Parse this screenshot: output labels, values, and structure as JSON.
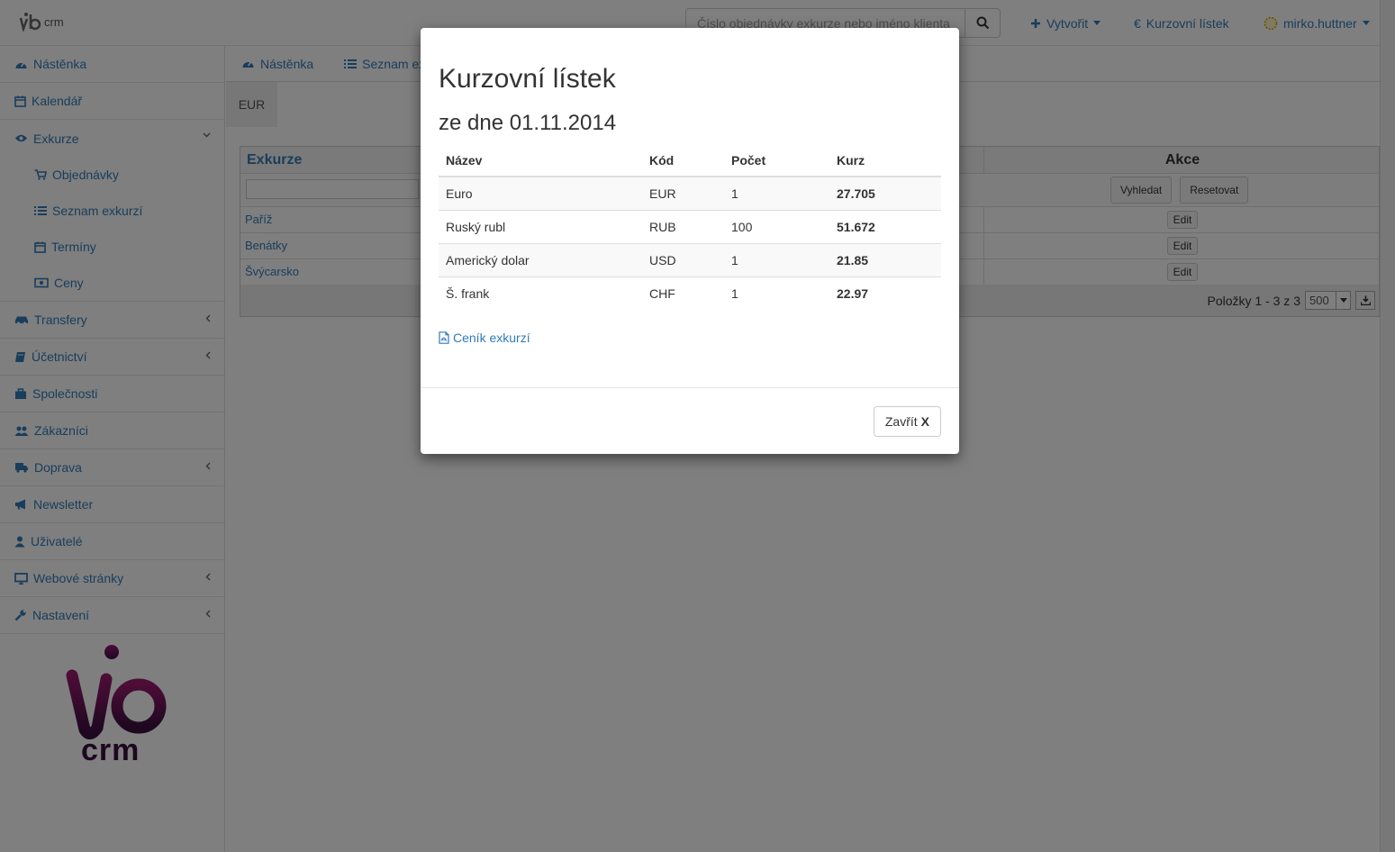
{
  "header": {
    "brand": "crm",
    "search_placeholder": "Číslo objednávky exkurze nebo jméno klienta",
    "nav": {
      "create": "Vytvořit",
      "rates": "Kurzovní lístek",
      "user": "mirko.huttner"
    }
  },
  "sidebar": {
    "items": [
      {
        "label": "Nástěnka",
        "icon": "dashboard-icon"
      },
      {
        "label": "Kalendář",
        "icon": "calendar-icon"
      },
      {
        "label": "Exkurze",
        "icon": "eye-icon"
      },
      {
        "label": "Transfery",
        "icon": "car-icon"
      },
      {
        "label": "Účetnictví",
        "icon": "book-icon"
      },
      {
        "label": "Společnosti",
        "icon": "briefcase-icon"
      },
      {
        "label": "Zákazníci",
        "icon": "users-icon"
      },
      {
        "label": "Doprava",
        "icon": "truck-icon"
      },
      {
        "label": "Newsletter",
        "icon": "bullhorn-icon"
      },
      {
        "label": "Uživatelé",
        "icon": "user-icon"
      },
      {
        "label": "Webové stránky",
        "icon": "desktop-icon"
      },
      {
        "label": "Nastavení",
        "icon": "wrench-icon"
      }
    ],
    "sub_items": [
      {
        "label": "Objednávky",
        "icon": "cart-icon"
      },
      {
        "label": "Seznam exkurzí",
        "icon": "list-icon"
      },
      {
        "label": "Termíny",
        "icon": "calendar-icon"
      },
      {
        "label": "Ceny",
        "icon": "money-icon"
      }
    ],
    "logo_text": "crm"
  },
  "main": {
    "tabs": [
      {
        "label": "Nástěnka"
      },
      {
        "label": "Seznam ex"
      }
    ],
    "current_tab": "EUR",
    "grid": {
      "col_name": "Exkurze",
      "col_actions": "Akce",
      "search_btn": "Vyhledat",
      "reset_btn": "Resetovat",
      "edit_label": "Edit",
      "rows": [
        "Paříž",
        "Benátky",
        "Švýcarsko"
      ],
      "footer_text": "Položky 1 - 3 z 3",
      "page_size": "500"
    }
  },
  "modal": {
    "title": "Kurzovní lístek",
    "subtitle": "ze dne 01.11.2014",
    "columns": [
      "Název",
      "Kód",
      "Počet",
      "Kurz"
    ],
    "rows": [
      {
        "name": "Euro",
        "code": "EUR",
        "count": "1",
        "rate": "27.705"
      },
      {
        "name": "Ruský rubl",
        "code": "RUB",
        "count": "100",
        "rate": "51.672"
      },
      {
        "name": "Americký dolar",
        "code": "USD",
        "count": "1",
        "rate": "21.85"
      },
      {
        "name": "Š. frank",
        "code": "CHF",
        "count": "1",
        "rate": "22.97"
      }
    ],
    "pdf_link": "Ceník exkurzí",
    "close_label": "Zavřít",
    "close_x": "X"
  },
  "colors": {
    "link": "#337ab7",
    "backdrop": "rgba(0,0,0,0.5)",
    "logo_gradient_top": "#9b1a6e",
    "logo_gradient_bottom": "#3a1040"
  }
}
